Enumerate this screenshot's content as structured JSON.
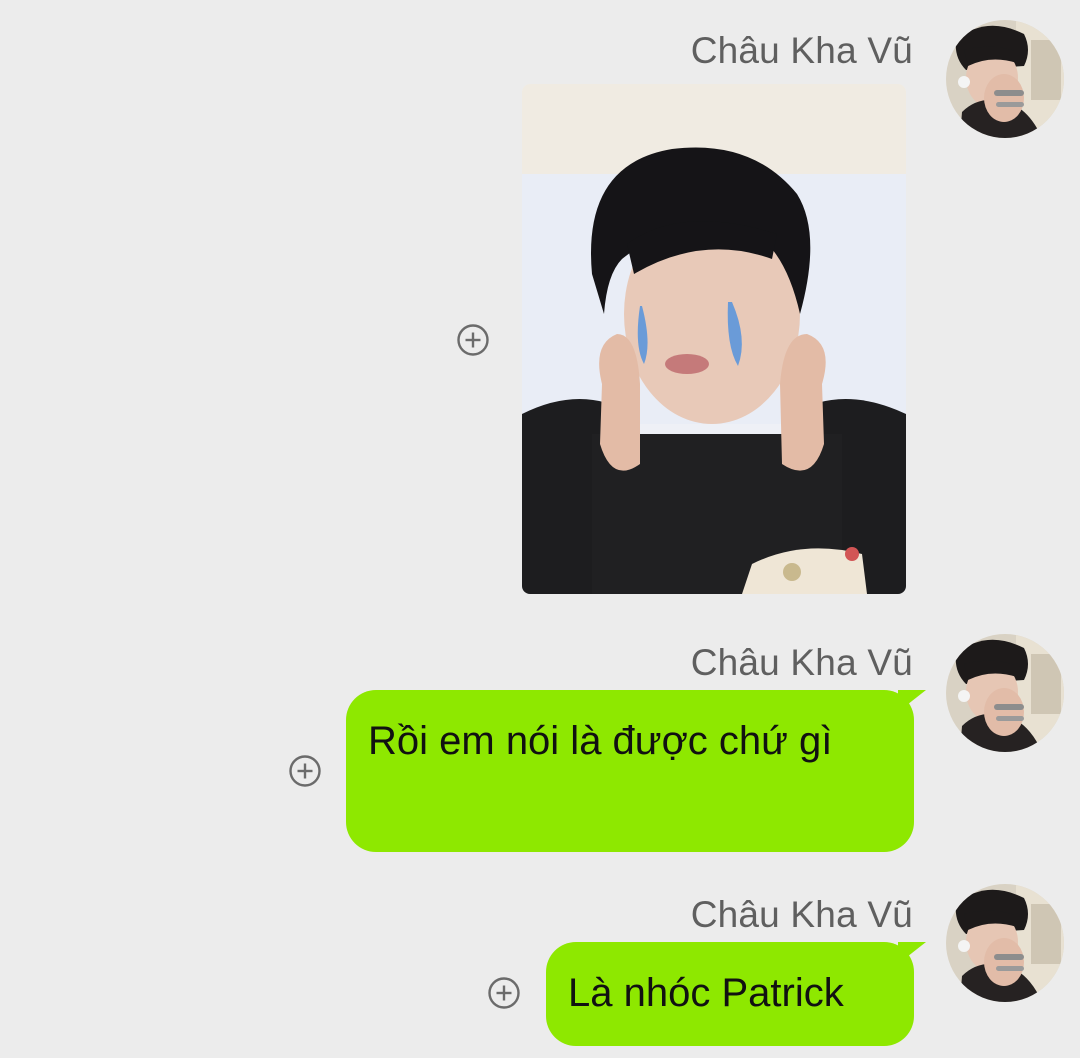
{
  "messages": [
    {
      "sender": "Châu Kha Vũ",
      "type": "image",
      "image_alt": "crying boy sticker",
      "avatar_icon": "person-avatar-icon",
      "add_icon": "plus-circle-icon"
    },
    {
      "sender": "Châu Kha Vũ",
      "type": "text",
      "text": "Rồi em nói là được chứ gì",
      "avatar_icon": "person-avatar-icon",
      "add_icon": "plus-circle-icon"
    },
    {
      "sender": "Châu Kha Vũ",
      "type": "text",
      "text": "Là nhóc Patrick",
      "avatar_icon": "person-avatar-icon",
      "add_icon": "plus-circle-icon"
    }
  ],
  "colors": {
    "background": "#ececec",
    "bubble": "#8ee800",
    "sender_text": "#5f5f5f"
  }
}
